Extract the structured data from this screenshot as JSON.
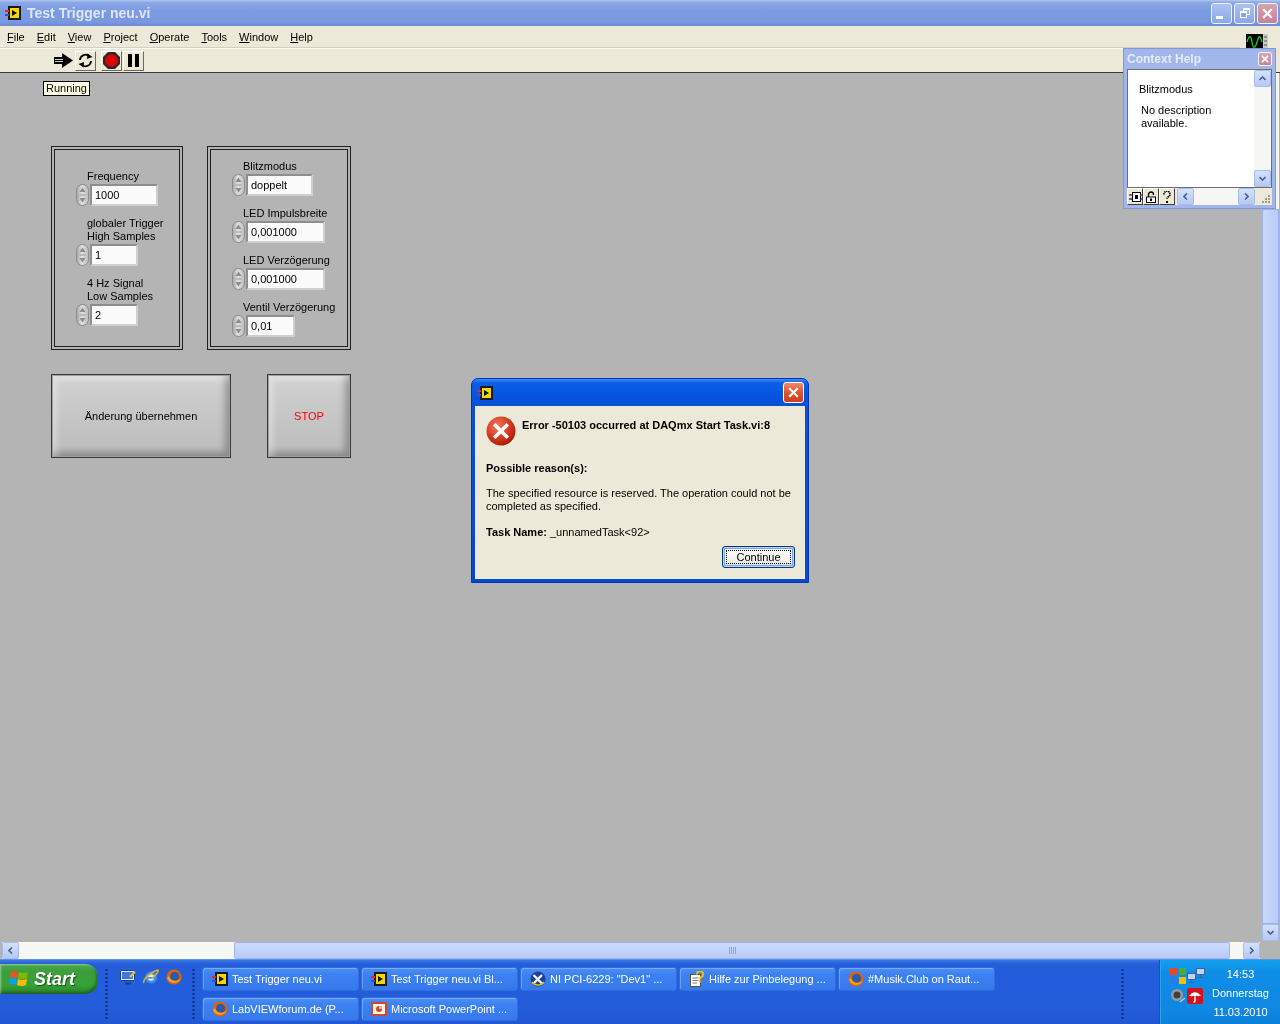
{
  "window": {
    "title": "Test Trigger neu.vi"
  },
  "menu": [
    "File",
    "Edit",
    "View",
    "Project",
    "Operate",
    "Tools",
    "Window",
    "Help"
  ],
  "toolbar": [
    {
      "kind": "run"
    },
    {
      "kind": "run-continuously"
    },
    {
      "kind": "abort"
    },
    {
      "kind": "pause"
    }
  ],
  "panel": {
    "status": "Running",
    "clusters": [
      {
        "controls": [
          {
            "label": "Frequency",
            "value": "1000"
          },
          {
            "label": "globaler Trigger\nHigh Samples",
            "value": "1"
          },
          {
            "label": "4 Hz Signal\nLow Samples",
            "value": "2"
          }
        ]
      },
      {
        "controls": [
          {
            "label": "Blitzmodus",
            "value": "doppelt"
          },
          {
            "label": "LED Impulsbreite",
            "value": "0,001000"
          },
          {
            "label": "LED Verzögerung",
            "value": "0,001000"
          },
          {
            "label": "Ventil Verzögerung",
            "value": "0,01"
          }
        ]
      }
    ],
    "buttons": [
      {
        "label": "Änderung übernehmen",
        "kind": "boolean"
      },
      {
        "label": "STOP",
        "kind": "stop"
      }
    ]
  },
  "context_help": {
    "title": "Context Help",
    "heading": "Blitzmodus",
    "description": "No description\navailable."
  },
  "dialog": {
    "heading": "Error -50103 occurred at DAQmx Start Task.vi:8",
    "reason_title": "Possible reason(s):",
    "reason": "The specified resource is reserved. The operation could not be completed as specified.",
    "task": "**Task Name:** _unnamedTask<92>",
    "buttons": [
      {
        "label": "Continue",
        "focused": true
      }
    ]
  },
  "taskbar": {
    "start": "Start",
    "quick_launch": [
      {
        "kind": "desktop"
      },
      {
        "kind": "ie"
      },
      {
        "kind": "firefox"
      }
    ],
    "tasks": [
      {
        "label": "Test Trigger neu.vi",
        "kind": "labview",
        "selected": false
      },
      {
        "label": "Test Trigger neu.vi Bl...",
        "kind": "labview",
        "selected": false
      },
      {
        "label": "NI PCI-6229: \"Dev1\" ...",
        "kind": "ni",
        "selected": false
      },
      {
        "label": "Hilfe zur Pinbelegung ...",
        "kind": "help",
        "selected": false
      },
      {
        "label": "#Musik.Club on Raut...",
        "kind": "firefox",
        "selected": false
      },
      {
        "label": "LabVIEWforum.de (P...",
        "kind": "firefox",
        "selected": false
      },
      {
        "label": "Microsoft PowerPoint ...",
        "kind": "powerpoint",
        "selected": false
      }
    ],
    "tray": {
      "icons": [
        {
          "kind": "office"
        },
        {
          "kind": "network"
        },
        {
          "kind": "speaker"
        },
        {
          "kind": "antivirus"
        }
      ],
      "time": "14:53",
      "day": "Donnerstag",
      "date": "11.03.2010"
    }
  }
}
